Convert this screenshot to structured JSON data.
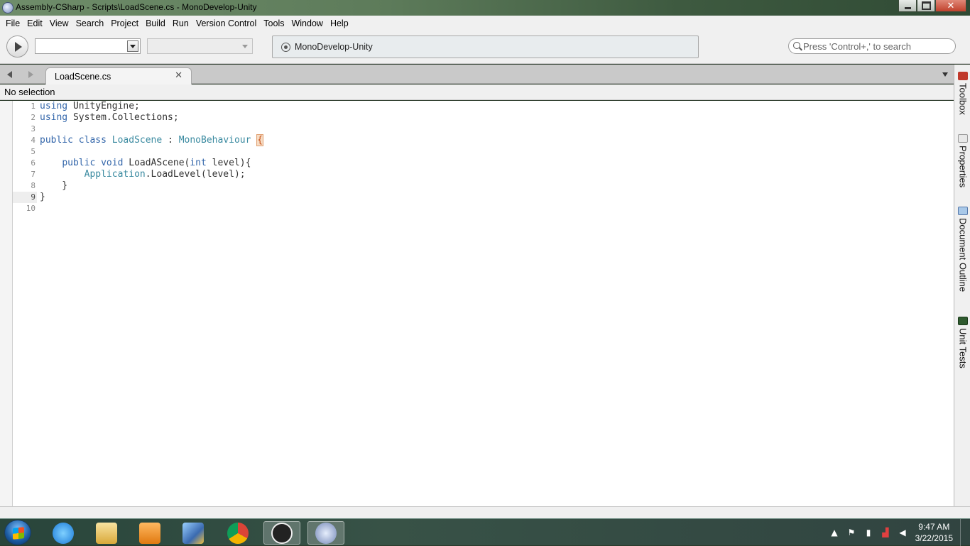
{
  "window": {
    "title": "Assembly-CSharp - Scripts\\LoadScene.cs - MonoDevelop-Unity",
    "close_glyph": "✕"
  },
  "menu": [
    "File",
    "Edit",
    "View",
    "Search",
    "Project",
    "Build",
    "Run",
    "Version Control",
    "Tools",
    "Window",
    "Help"
  ],
  "toolbar": {
    "config_value": "",
    "platform_value": "",
    "status_text": "MonoDevelop-Unity",
    "search_placeholder": "Press 'Control+,' to search"
  },
  "tabs": [
    {
      "label": "LoadScene.cs",
      "active": true,
      "close_glyph": "✕"
    }
  ],
  "breadcrumb": "No selection",
  "pads": [
    "Toolbox",
    "Properties",
    "Document Outline",
    "Unit Tests"
  ],
  "editor": {
    "current_line": 9,
    "line_numbers": [
      "1",
      "2",
      "3",
      "4",
      "5",
      "6",
      "7",
      "8",
      "9",
      "10"
    ]
  },
  "taskbar": {
    "apps": [
      "internet-explorer",
      "file-explorer",
      "media-player",
      "paint-tool",
      "chrome",
      "unity",
      "monodevelop"
    ],
    "active_app": "monodevelop",
    "clock": {
      "time": "9:47 AM",
      "date": "3/22/2015"
    }
  }
}
